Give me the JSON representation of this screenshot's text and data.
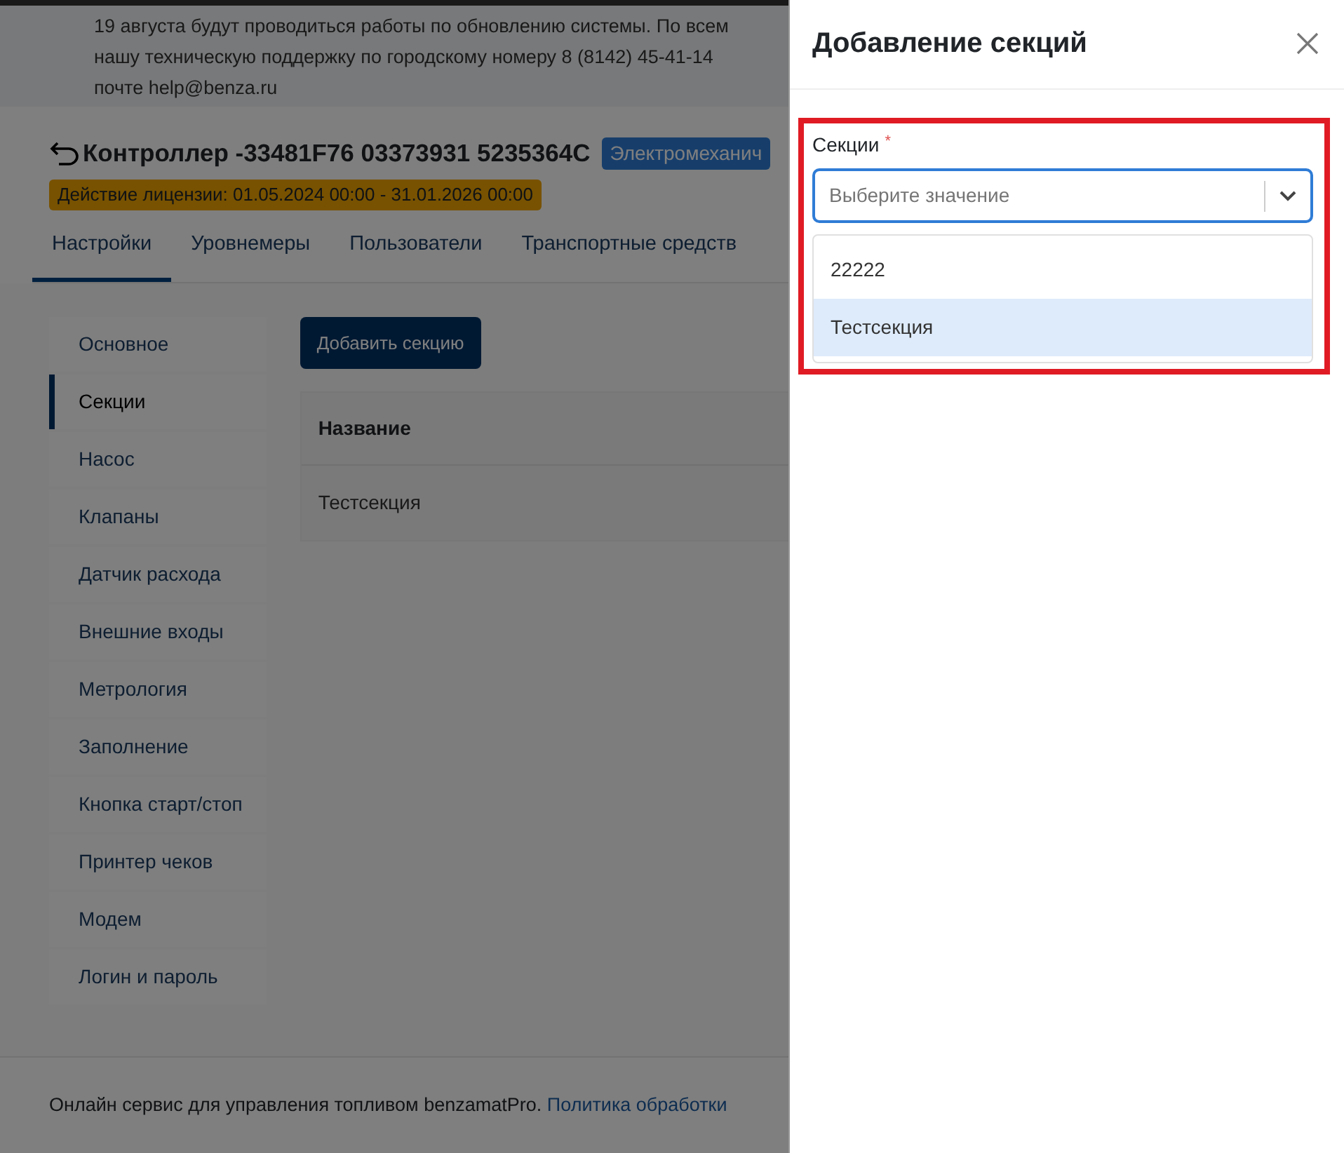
{
  "notice": {
    "lines": [
      "19 августа будут проводиться работы по обновлению системы. По всем",
      "нашу техническую поддержку по городскому номеру 8 (8142) 45-41-14",
      "почте help@benza.ru"
    ]
  },
  "header": {
    "title": "Контроллер -33481F76 03373931 5235364C",
    "type_badge": "Электромеханич",
    "license": "Действие лицензии: 01.05.2024 00:00 - 31.01.2026 00:00"
  },
  "tabs": [
    {
      "label": "Настройки",
      "selected": true
    },
    {
      "label": "Уровнемеры",
      "selected": false
    },
    {
      "label": "Пользователи",
      "selected": false
    },
    {
      "label": "Транспортные средств",
      "selected": false
    }
  ],
  "sidebar": {
    "items": [
      {
        "label": "Основное",
        "selected": false
      },
      {
        "label": "Секции",
        "selected": true
      },
      {
        "label": "Насос",
        "selected": false
      },
      {
        "label": "Клапаны",
        "selected": false
      },
      {
        "label": "Датчик расхода",
        "selected": false
      },
      {
        "label": "Внешние входы",
        "selected": false
      },
      {
        "label": "Метрология",
        "selected": false
      },
      {
        "label": "Заполнение",
        "selected": false
      },
      {
        "label": "Кнопка старт/стоп",
        "selected": false
      },
      {
        "label": "Принтер чеков",
        "selected": false
      },
      {
        "label": "Модем",
        "selected": false
      },
      {
        "label": "Логин и пароль",
        "selected": false
      }
    ]
  },
  "add_button": "Добавить секцию",
  "table": {
    "columns": [
      "Название"
    ],
    "rows": [
      [
        "Тестсекция"
      ]
    ]
  },
  "footer": {
    "text": "Онлайн сервис для управления топливом benzamatPro.",
    "link": "Политика обработки"
  },
  "dialog": {
    "title": "Добавление секций",
    "field": {
      "label": "Секции",
      "required_mark": "*",
      "placeholder": "Выберите значение",
      "options": [
        {
          "label": "22222",
          "selected": false
        },
        {
          "label": "Тестсекция",
          "selected": true
        }
      ]
    }
  }
}
